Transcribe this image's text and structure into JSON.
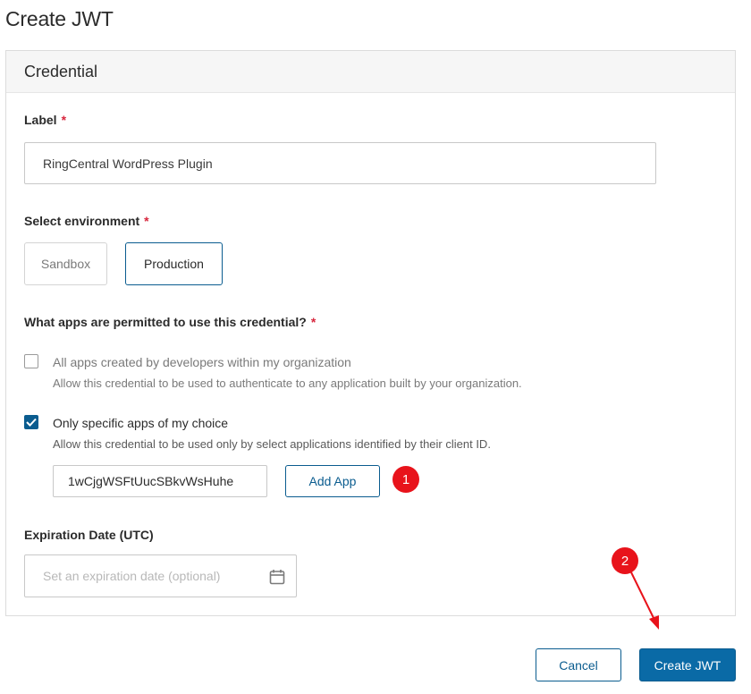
{
  "page": {
    "title": "Create JWT"
  },
  "credential": {
    "section_title": "Credential",
    "label": {
      "text": "Label",
      "required_mark": "*",
      "value": "RingCentral WordPress Plugin"
    },
    "environment": {
      "text": "Select environment",
      "required_mark": "*",
      "options": [
        "Sandbox",
        "Production"
      ],
      "selected": "Production"
    },
    "apps": {
      "question": "What apps are permitted to use this credential?",
      "required_mark": "*",
      "options": [
        {
          "title": "All apps created by developers within my organization",
          "description": "Allow this credential to be used to authenticate to any application built by your organization.",
          "checked": false
        },
        {
          "title": "Only specific apps of my choice",
          "description": "Allow this credential to be used only by select applications identified by their client ID.",
          "checked": true
        }
      ],
      "client_id_value": "1wCjgWSFtUucSBkvWsHuhe",
      "add_app_label": "Add App"
    },
    "expiration": {
      "text": "Expiration Date (UTC)",
      "placeholder": "Set an expiration date (optional)",
      "icon": "calendar-icon"
    }
  },
  "footer": {
    "cancel_label": "Cancel",
    "create_label": "Create JWT"
  },
  "annotations": {
    "marker_1": "1",
    "marker_2": "2"
  },
  "colors": {
    "primary": "#0a6aa6",
    "primary_border": "#0a5c8f",
    "required": "#d7263d",
    "annotation": "#e8131b"
  }
}
